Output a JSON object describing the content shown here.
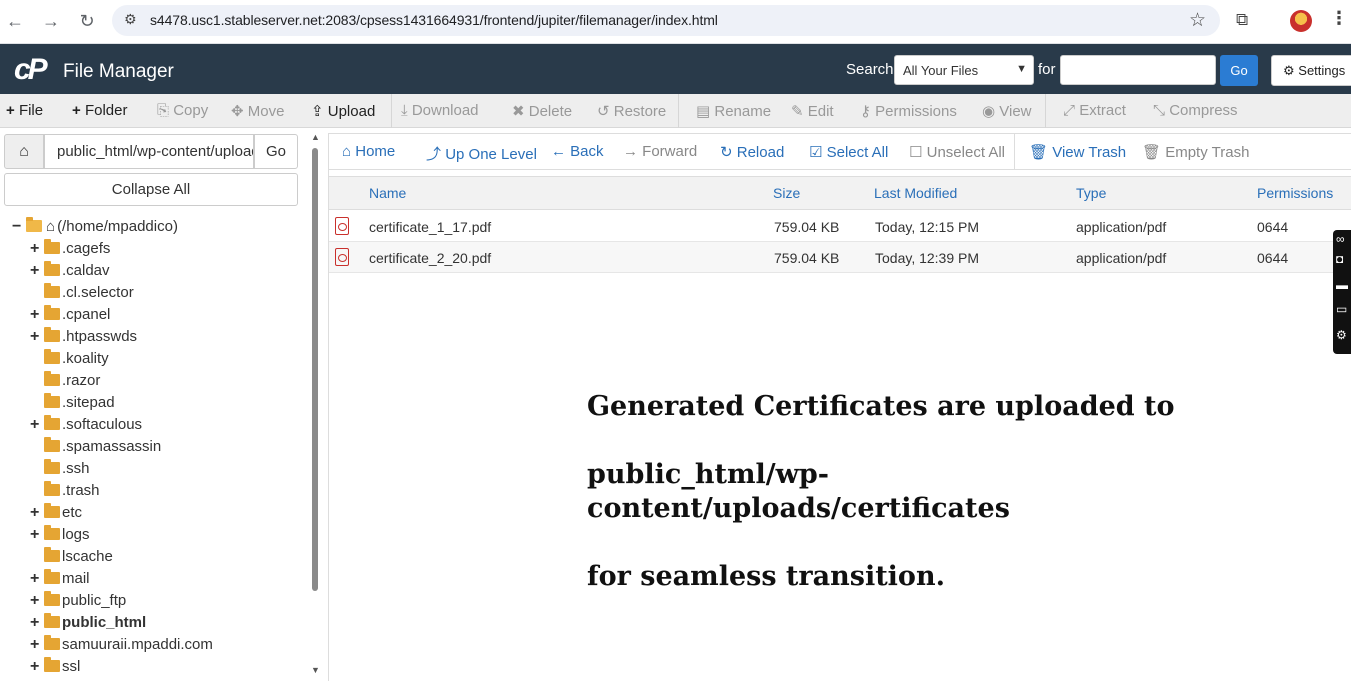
{
  "browser": {
    "url": "s4478.usc1.stableserver.net:2083/cpsess1431664931/frontend/jupiter/filemanager/index.html"
  },
  "header": {
    "logo": "cP",
    "title": "File Manager",
    "search_label": "Search",
    "search_scope": "All Your Files",
    "for_label": "for",
    "search_value": "",
    "go_label": "Go",
    "settings_label": "Settings"
  },
  "toolbar": {
    "file": "File",
    "folder": "Folder",
    "copy": "Copy",
    "move": "Move",
    "upload": "Upload",
    "download": "Download",
    "delete": "Delete",
    "restore": "Restore",
    "rename": "Rename",
    "edit": "Edit",
    "permissions": "Permissions",
    "view": "View",
    "extract": "Extract",
    "compress": "Compress"
  },
  "left": {
    "path_value": "public_html/wp-content/uploads/certificates",
    "go_label": "Go",
    "collapse_label": "Collapse All",
    "tree": [
      {
        "label": "(/home/mpaddico)",
        "toggle": "−",
        "root": true
      },
      {
        "label": ".cagefs",
        "toggle": "+"
      },
      {
        "label": ".caldav",
        "toggle": "+"
      },
      {
        "label": ".cl.selector",
        "toggle": ""
      },
      {
        "label": ".cpanel",
        "toggle": "+"
      },
      {
        "label": ".htpasswds",
        "toggle": "+"
      },
      {
        "label": ".koality",
        "toggle": ""
      },
      {
        "label": ".razor",
        "toggle": ""
      },
      {
        "label": ".sitepad",
        "toggle": ""
      },
      {
        "label": ".softaculous",
        "toggle": "+"
      },
      {
        "label": ".spamassassin",
        "toggle": ""
      },
      {
        "label": ".ssh",
        "toggle": ""
      },
      {
        "label": ".trash",
        "toggle": ""
      },
      {
        "label": "etc",
        "toggle": "+"
      },
      {
        "label": "logs",
        "toggle": "+"
      },
      {
        "label": "lscache",
        "toggle": ""
      },
      {
        "label": "mail",
        "toggle": "+"
      },
      {
        "label": "public_ftp",
        "toggle": "+"
      },
      {
        "label": "public_html",
        "toggle": "+",
        "bold": true
      },
      {
        "label": "samuuraii.mpaddi.com",
        "toggle": "+"
      },
      {
        "label": "ssl",
        "toggle": "+"
      }
    ]
  },
  "nav": {
    "home": "Home",
    "up": "Up One Level",
    "back": "Back",
    "forward": "Forward",
    "reload": "Reload",
    "select_all": "Select All",
    "unselect_all": "Unselect All",
    "view_trash": "View Trash",
    "empty_trash": "Empty Trash"
  },
  "table": {
    "headers": [
      "Name",
      "Size",
      "Last Modified",
      "Type",
      "Permissions"
    ],
    "rows": [
      {
        "name": "certificate_1_17.pdf",
        "size": "759.04 KB",
        "modified": "Today, 12:15 PM",
        "type": "application/pdf",
        "perms": "0644"
      },
      {
        "name": "certificate_2_20.pdf",
        "size": "759.04 KB",
        "modified": "Today, 12:39 PM",
        "type": "application/pdf",
        "perms": "0644"
      }
    ]
  },
  "overlay": {
    "line1": "Generated Certificates are uploaded to",
    "line2": "public_html/wp-content/uploads/certificates",
    "line3": "for seamless transition."
  }
}
